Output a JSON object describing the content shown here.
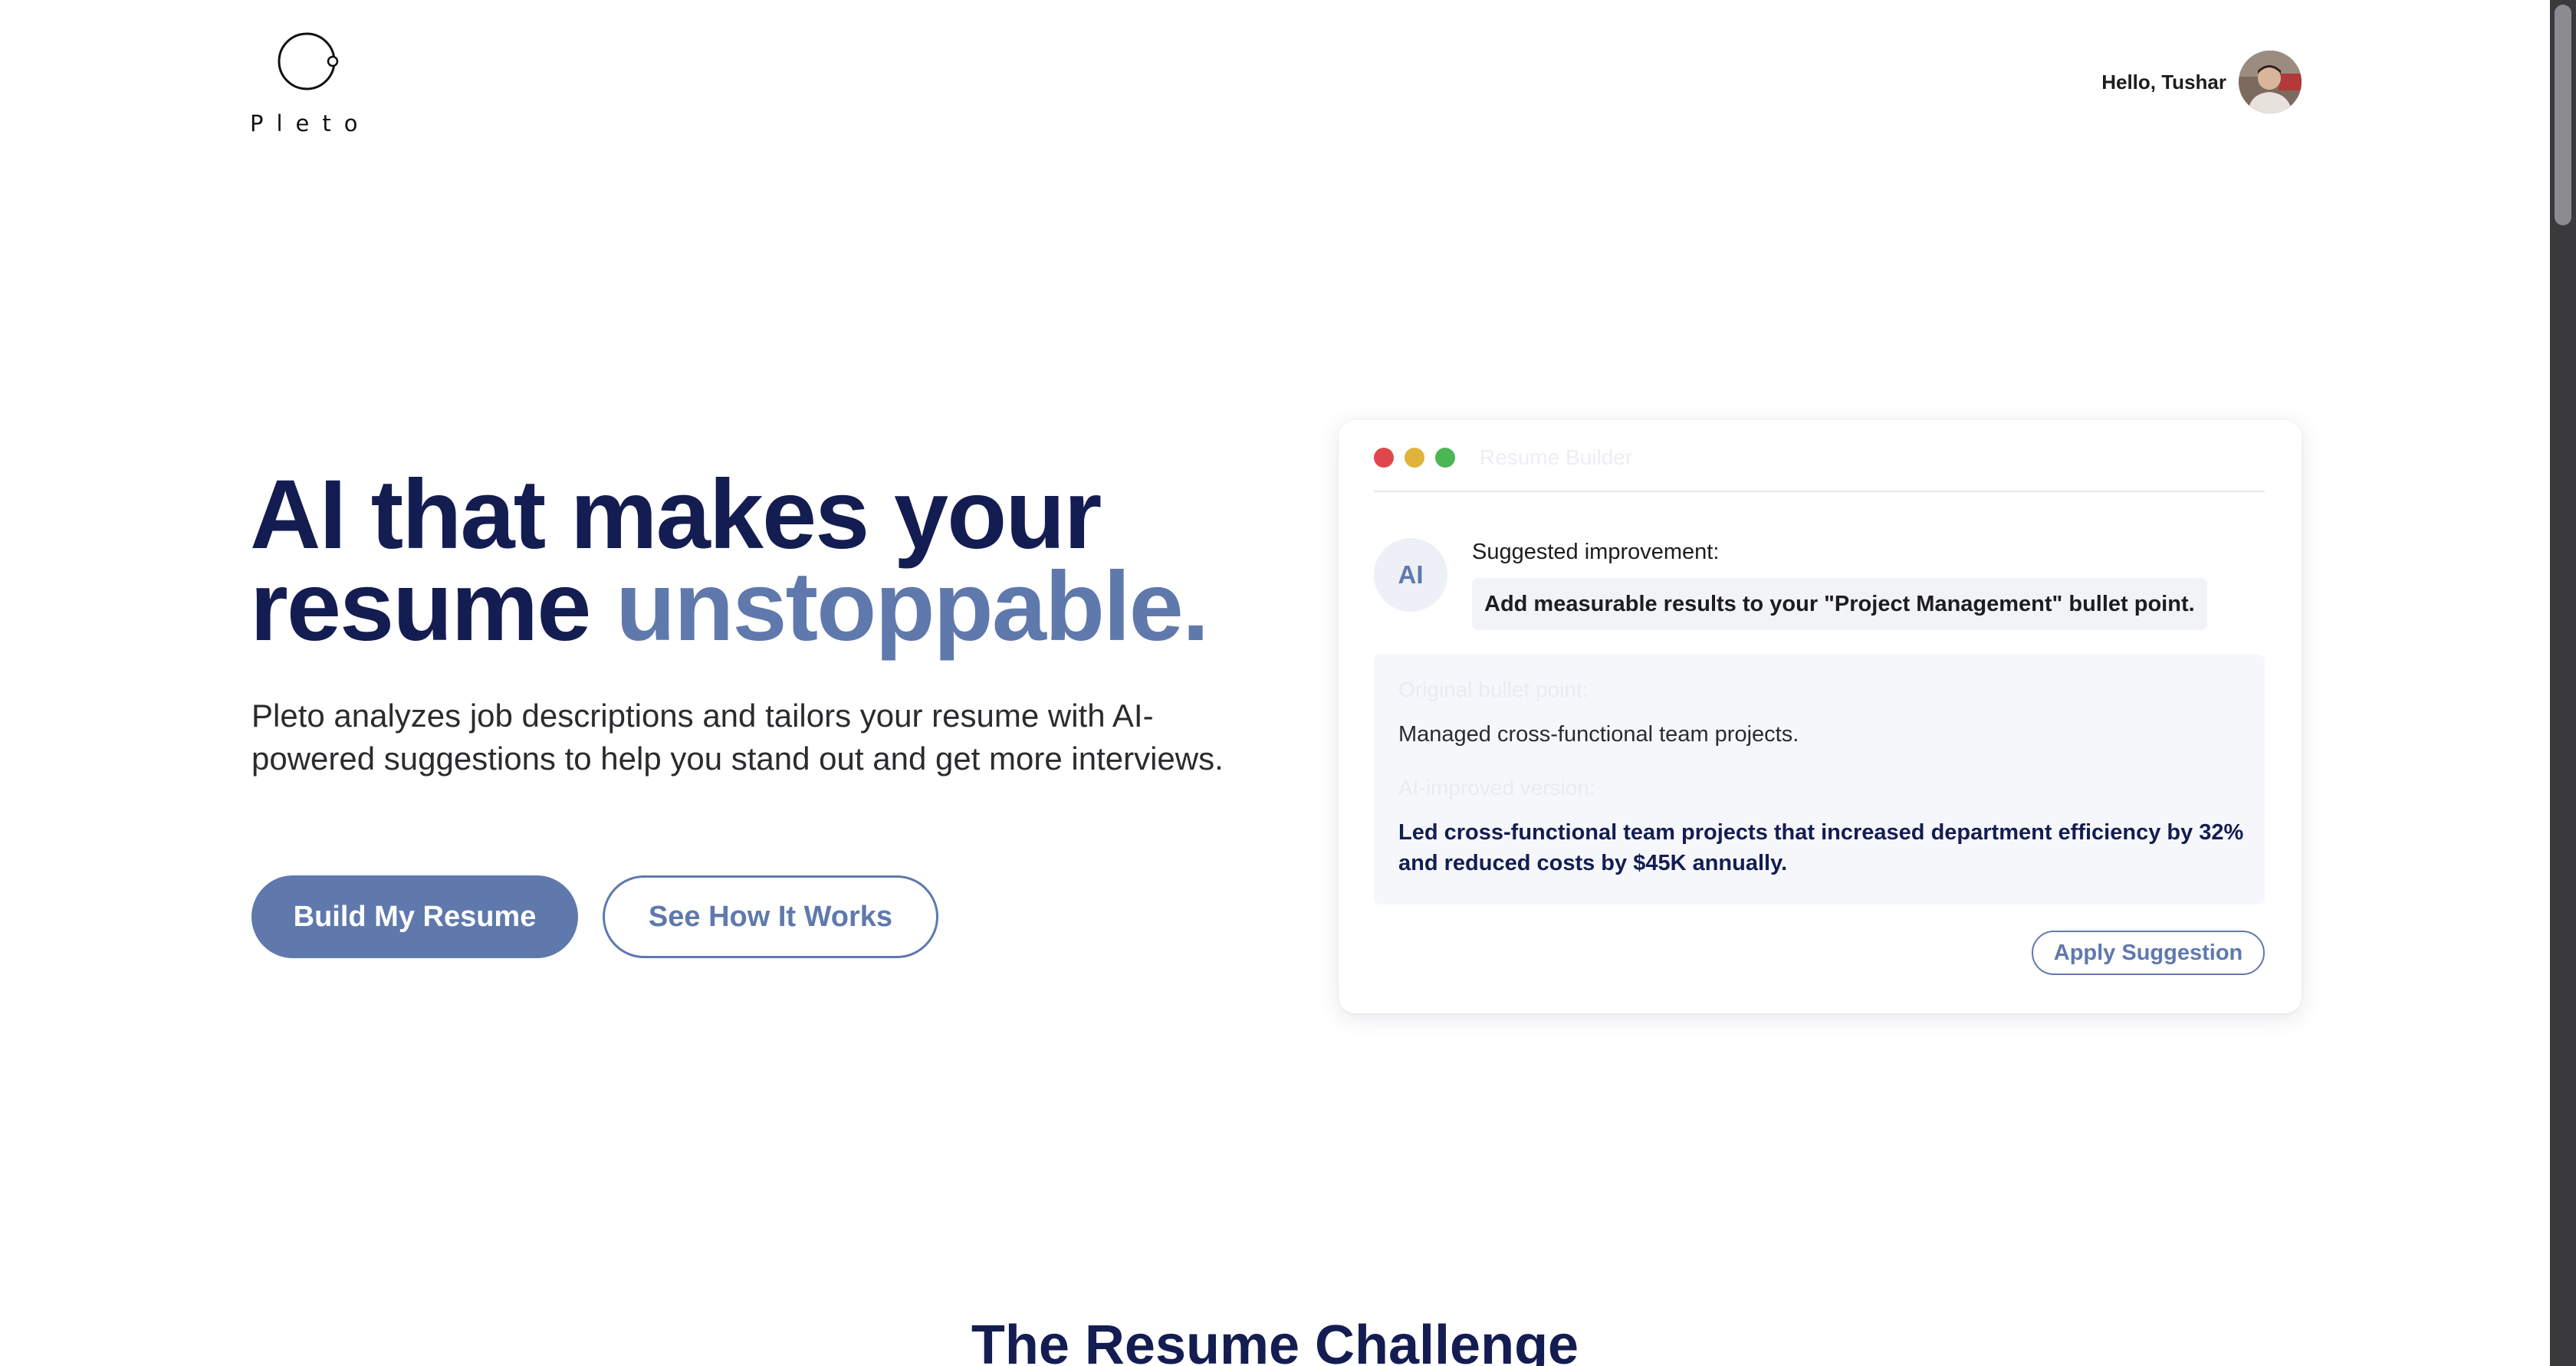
{
  "header": {
    "brand": "Pleto",
    "greeting": "Hello, Tushar",
    "logo_icon": "orbit-circle-logo",
    "avatar_icon": "user-avatar-photo"
  },
  "hero": {
    "title_line1": "AI that makes your",
    "title_line2_plain": "resume ",
    "title_line2_accent": "unstoppable.",
    "subtitle": "Pleto analyzes job descriptions and tailors your resume with AI-powered suggestions to help you stand out and get more interviews.",
    "primary_cta": "Build My Resume",
    "secondary_cta": "See How It Works"
  },
  "preview_card": {
    "window_title": "Resume Builder",
    "ai_badge": "AI",
    "suggestion_label": "Suggested improvement:",
    "suggestion_text": "Add measurable results to your \"Project Management\" bullet point.",
    "original_label": "Original bullet point:",
    "original_text": "Managed cross-functional team projects.",
    "improved_label": "AI-improved version:",
    "improved_text": "Led cross-functional team projects that increased department efficiency by 32% and reduced costs by $45K annually.",
    "apply_label": "Apply Suggestion"
  },
  "next_section": {
    "heading": "The Resume Challenge"
  },
  "colors": {
    "navy": "#141d51",
    "accent": "#5f79ad",
    "window_red": "#e0474c",
    "window_yellow": "#e0b43a",
    "window_green": "#4bb654"
  }
}
